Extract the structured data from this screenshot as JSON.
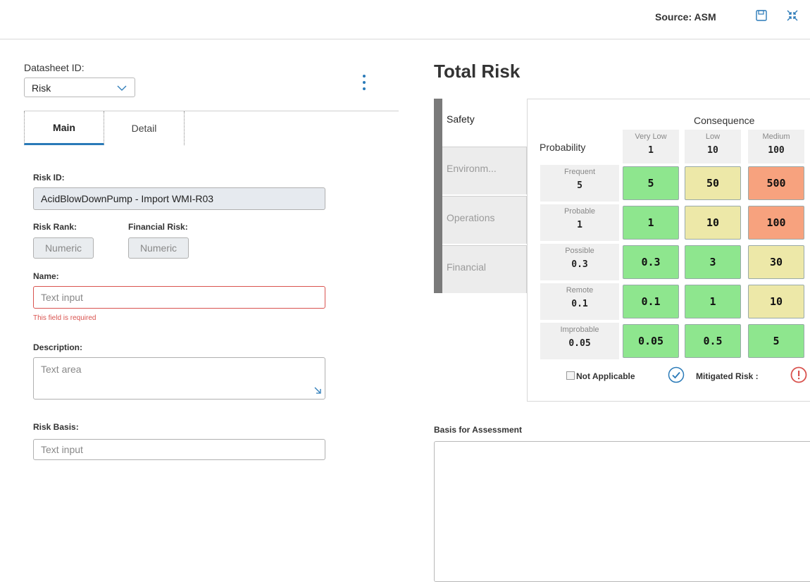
{
  "header": {
    "source_text": "Source: ASM",
    "save_icon": "save-icon",
    "collapse_icon": "collapse-icon"
  },
  "form": {
    "datasheet_label": "Datasheet ID:",
    "datasheet_value": "Risk",
    "tabs": [
      {
        "label": "Main",
        "active": true
      },
      {
        "label": "Detail",
        "active": false
      }
    ],
    "risk_id_label": "Risk ID:",
    "risk_id_value": "AcidBlowDownPump - Import WMI-R03",
    "risk_rank_label": "Risk Rank:",
    "risk_rank_placeholder": "Numeric",
    "financial_risk_label": "Financial Risk:",
    "financial_risk_placeholder": "Numeric",
    "name_label": "Name:",
    "name_placeholder": "Text input",
    "name_error": "This field is required",
    "description_label": "Description:",
    "description_placeholder": "Text area",
    "risk_basis_label": "Risk Basis:",
    "risk_basis_placeholder": "Text input"
  },
  "risk": {
    "title": "Total Risk",
    "categories": [
      {
        "label": "Safety",
        "active": true
      },
      {
        "label": "Environm...",
        "active": false
      },
      {
        "label": "Operations",
        "active": false
      },
      {
        "label": "Financial",
        "active": false
      }
    ],
    "consequence_title": "Consequence",
    "probability_title": "Probability",
    "columns": [
      {
        "name": "Very Low",
        "value": "1"
      },
      {
        "name": "Low",
        "value": "10"
      },
      {
        "name": "Medium",
        "value": "100"
      }
    ],
    "rows": [
      {
        "name": "Frequent",
        "value": "5",
        "cells": [
          "5",
          "50",
          "500"
        ],
        "colors": [
          "#8ee68e",
          "#ede8a8",
          "#f7a27e"
        ]
      },
      {
        "name": "Probable",
        "value": "1",
        "cells": [
          "1",
          "10",
          "100"
        ],
        "colors": [
          "#8ee68e",
          "#ede8a8",
          "#f7a27e"
        ]
      },
      {
        "name": "Possible",
        "value": "0.3",
        "cells": [
          "0.3",
          "3",
          "30"
        ],
        "colors": [
          "#8ee68e",
          "#8ee68e",
          "#ede8a8"
        ]
      },
      {
        "name": "Remote",
        "value": "0.1",
        "cells": [
          "0.1",
          "1",
          "10"
        ],
        "colors": [
          "#8ee68e",
          "#8ee68e",
          "#ede8a8"
        ]
      },
      {
        "name": "Improbable",
        "value": "0.05",
        "cells": [
          "0.05",
          "0.5",
          "5"
        ],
        "colors": [
          "#8ee68e",
          "#8ee68e",
          "#8ee68e"
        ]
      }
    ],
    "not_applicable_label": "Not Applicable",
    "mitigated_label": "Mitigated Risk :",
    "basis_label": "Basis for Assessment",
    "accent_color": "#2a7ab8",
    "error_color": "#d9534f"
  }
}
